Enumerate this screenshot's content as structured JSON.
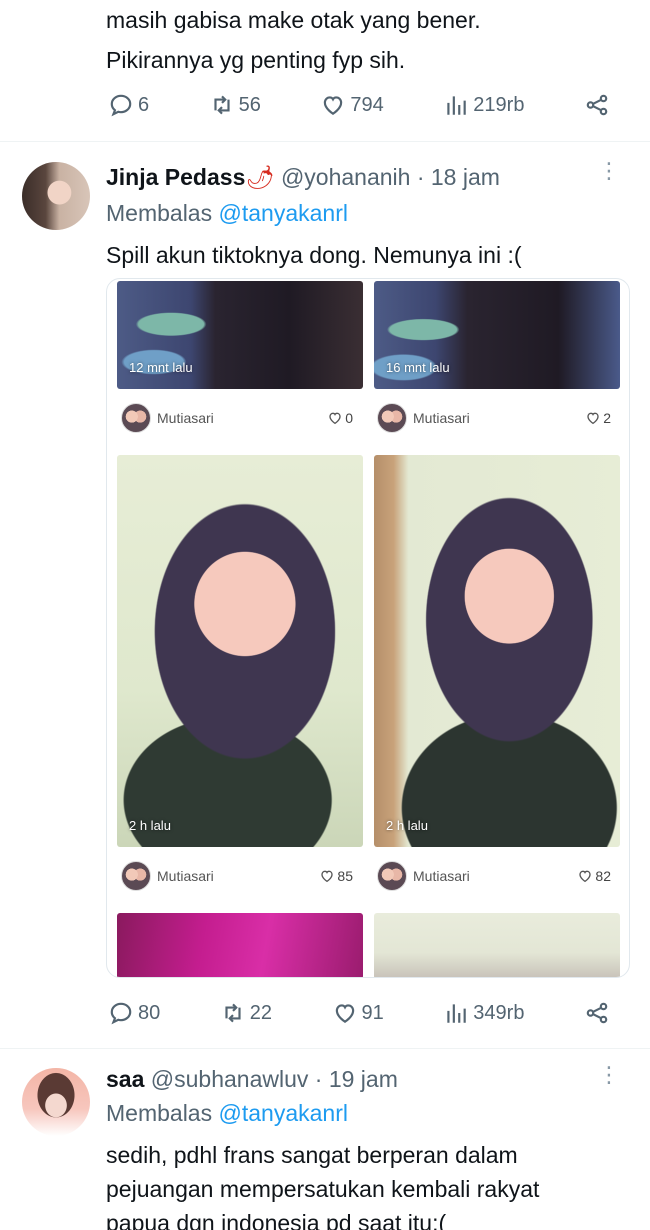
{
  "first_tweet": {
    "line1": "masih gabisa make otak yang bener.",
    "line2": "Pikirannya yg penting fyp sih.",
    "actions": {
      "replies": "6",
      "retweets": "56",
      "likes": "794",
      "views": "219rb"
    }
  },
  "second_tweet": {
    "name": "Jinja Pedass",
    "name_emoji": "🌶",
    "handle_time": "@yohananih · 18 jam",
    "reply_prefix": "Membalas",
    "reply_to": "@tanyakanrl",
    "text": "Spill akun tiktoknya dong. Nemunya ini :(",
    "media_tiles": [
      {
        "time": "12 mnt lalu",
        "user": "Mutiasari",
        "likes": "0"
      },
      {
        "time": "16 mnt lalu",
        "user": "Mutiasari",
        "likes": "2"
      },
      {
        "time": "2 h lalu",
        "user": "Mutiasari",
        "likes": "85"
      },
      {
        "time": "2 h lalu",
        "user": "Mutiasari",
        "likes": "82"
      }
    ],
    "actions": {
      "replies": "80",
      "retweets": "22",
      "likes": "91",
      "views": "349rb"
    }
  },
  "third_tweet": {
    "name": "saa",
    "handle_time": "@subhanawluv · 19 jam",
    "reply_prefix": "Membalas",
    "reply_to": "@tanyakanrl",
    "line1": "sedih, pdhl frans sangat berperan dalam",
    "line2": "pejuangan mempersatukan kembali rakyat",
    "line3": "papua dgn indonesia pd saat itu:("
  },
  "colors": {
    "link": "#1d9bf0",
    "muted": "#536471",
    "text": "#0f1419"
  }
}
